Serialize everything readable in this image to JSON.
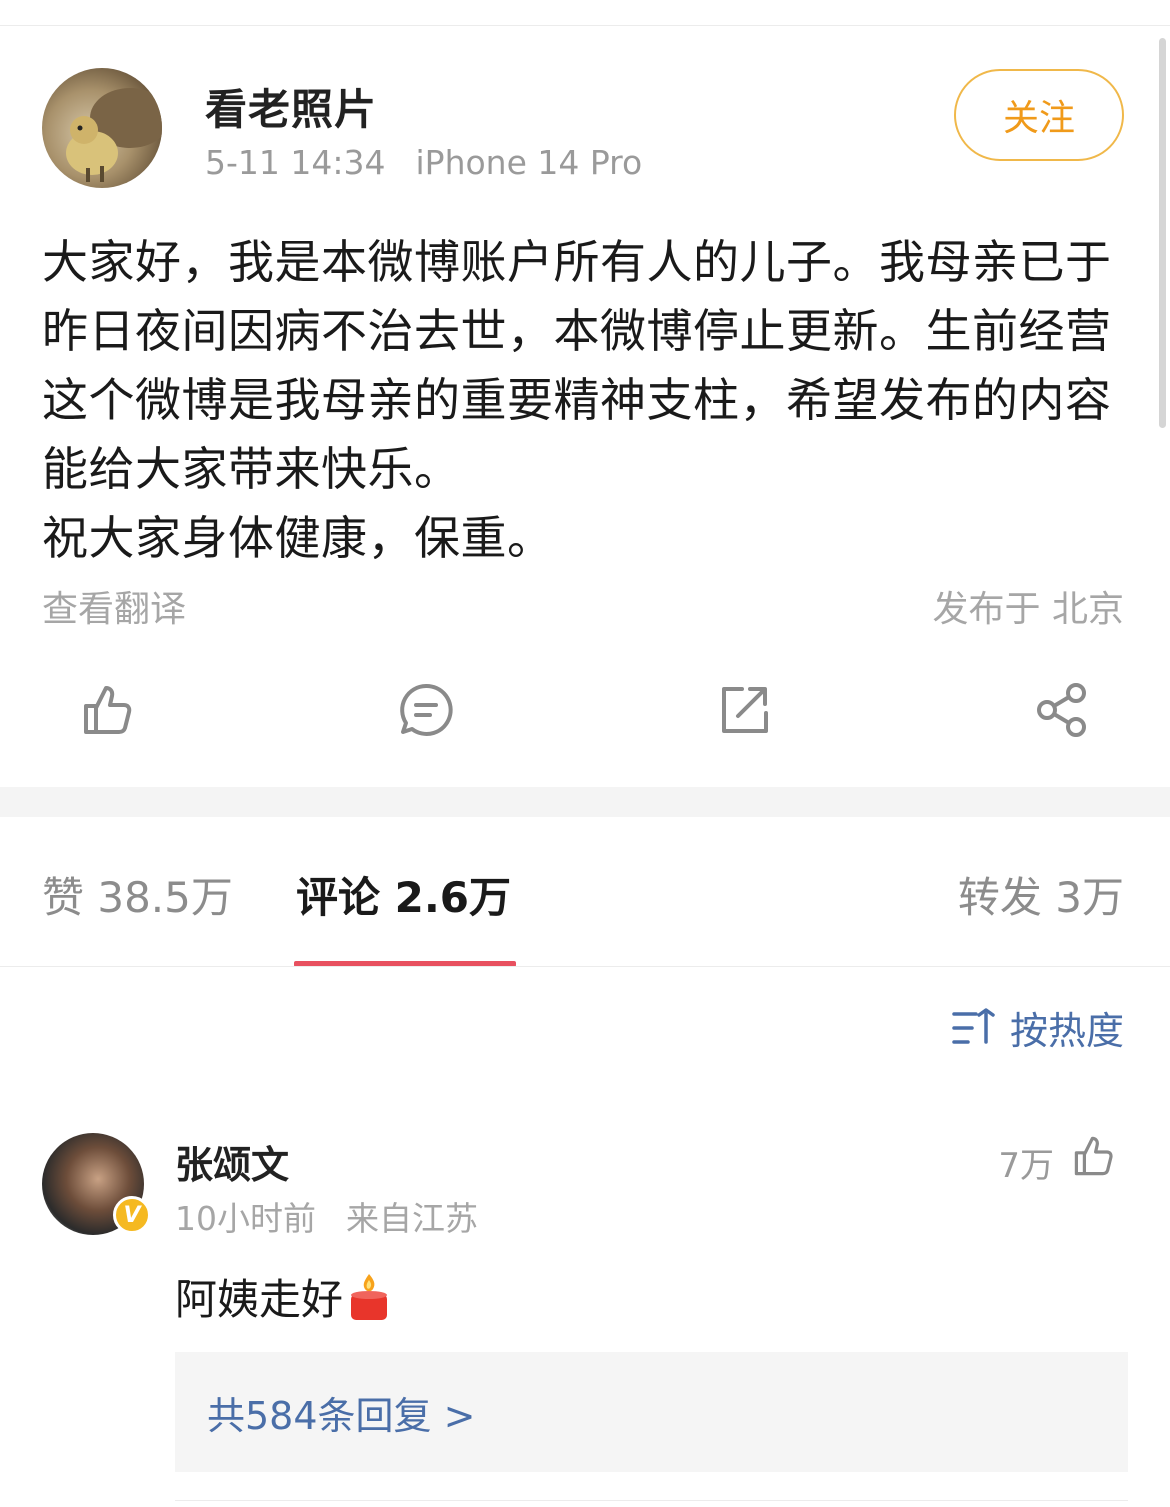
{
  "post": {
    "author": "看老照片",
    "time": "5-11 14:34",
    "device": "iPhone 14 Pro",
    "follow_label": "关注",
    "text": "大家好，我是本微博账户所有人的儿子。我母亲已于昨日夜间因病不治去世，本微博停止更新。生前经营这个微博是我母亲的重要精神支柱，希望发布的内容能给大家带来快乐。\n祝大家身体健康，保重。",
    "translate_label": "查看翻译",
    "location": "发布于 北京"
  },
  "actions": [
    {
      "icon": "thumbs-up-icon"
    },
    {
      "icon": "comment-icon"
    },
    {
      "icon": "repost-icon"
    },
    {
      "icon": "share-icon"
    }
  ],
  "tabs": {
    "likes": "赞 38.5万",
    "comments": "评论 2.6万",
    "reposts": "转发 3万"
  },
  "sort_label": "按热度",
  "comment": {
    "name": "张颂文",
    "time": "10小时前",
    "source": "来自江苏",
    "likes": "7万",
    "text": "阿姨走好",
    "badge": "V",
    "replies": "共584条回复 >"
  },
  "colors": {
    "follow": "#f09a1a",
    "tab_underline": "#e8505f",
    "link": "#4a6ea8",
    "verified_badge": "#f5b921"
  }
}
